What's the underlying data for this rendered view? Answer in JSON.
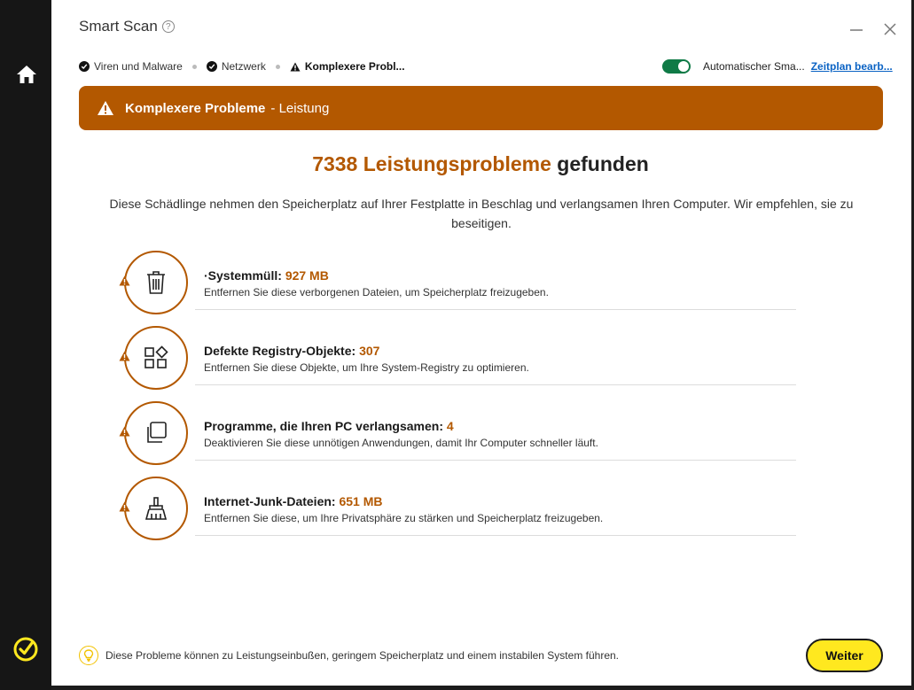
{
  "window": {
    "title": "Smart Scan",
    "help_icon": "?"
  },
  "steps": [
    {
      "label": "Viren und Malware",
      "state": "done"
    },
    {
      "label": "Netzwerk",
      "state": "done"
    },
    {
      "label": "Komplexere Probl...",
      "state": "active"
    }
  ],
  "schedule": {
    "auto_label": "Automatischer Sma...",
    "link_label": "Zeitplan bearb...",
    "toggle_on": true
  },
  "banner": {
    "title": "Komplexere Probleme",
    "subtitle": "- Leistung",
    "color": "#b35800"
  },
  "headline": {
    "count": "7338",
    "accent_text": "Leistungsprobleme",
    "rest": "gefunden"
  },
  "description": "Diese Schädlinge nehmen den Speicherplatz auf Ihrer Festplatte in Beschlag und verlangsamen Ihren Computer. Wir empfehlen, sie zu beseitigen.",
  "issues": [
    {
      "icon": "trash-icon",
      "title": "·Systemmüll:",
      "value": "927 MB",
      "subtitle": "Entfernen Sie diese verborgenen Dateien, um Speicherplatz freizugeben."
    },
    {
      "icon": "registry-icon",
      "title": "Defekte Registry-Objekte:",
      "value": "307",
      "subtitle": "Entfernen Sie diese Objekte, um Ihre System-Registry zu optimieren."
    },
    {
      "icon": "programs-icon",
      "title": "Programme, die Ihren PC verlangsamen:",
      "value": "4",
      "subtitle": "Deaktivieren Sie diese unnötigen Anwendungen, damit Ihr Computer schneller läuft."
    },
    {
      "icon": "broom-icon",
      "title": "Internet-Junk-Dateien:",
      "value": "651 MB",
      "subtitle": "Entfernen Sie diese, um Ihre Privatsphäre zu stärken und Speicherplatz freizugeben."
    }
  ],
  "footer": {
    "hint": "Diese Probleme können zu Leistungseinbußen, geringem Speicherplatz und einem instabilen System führen.",
    "next_label": "Weiter"
  },
  "colors": {
    "accent": "#b35800",
    "toggle": "#0f7a46",
    "button": "#ffe81f",
    "link": "#0b63c4"
  }
}
